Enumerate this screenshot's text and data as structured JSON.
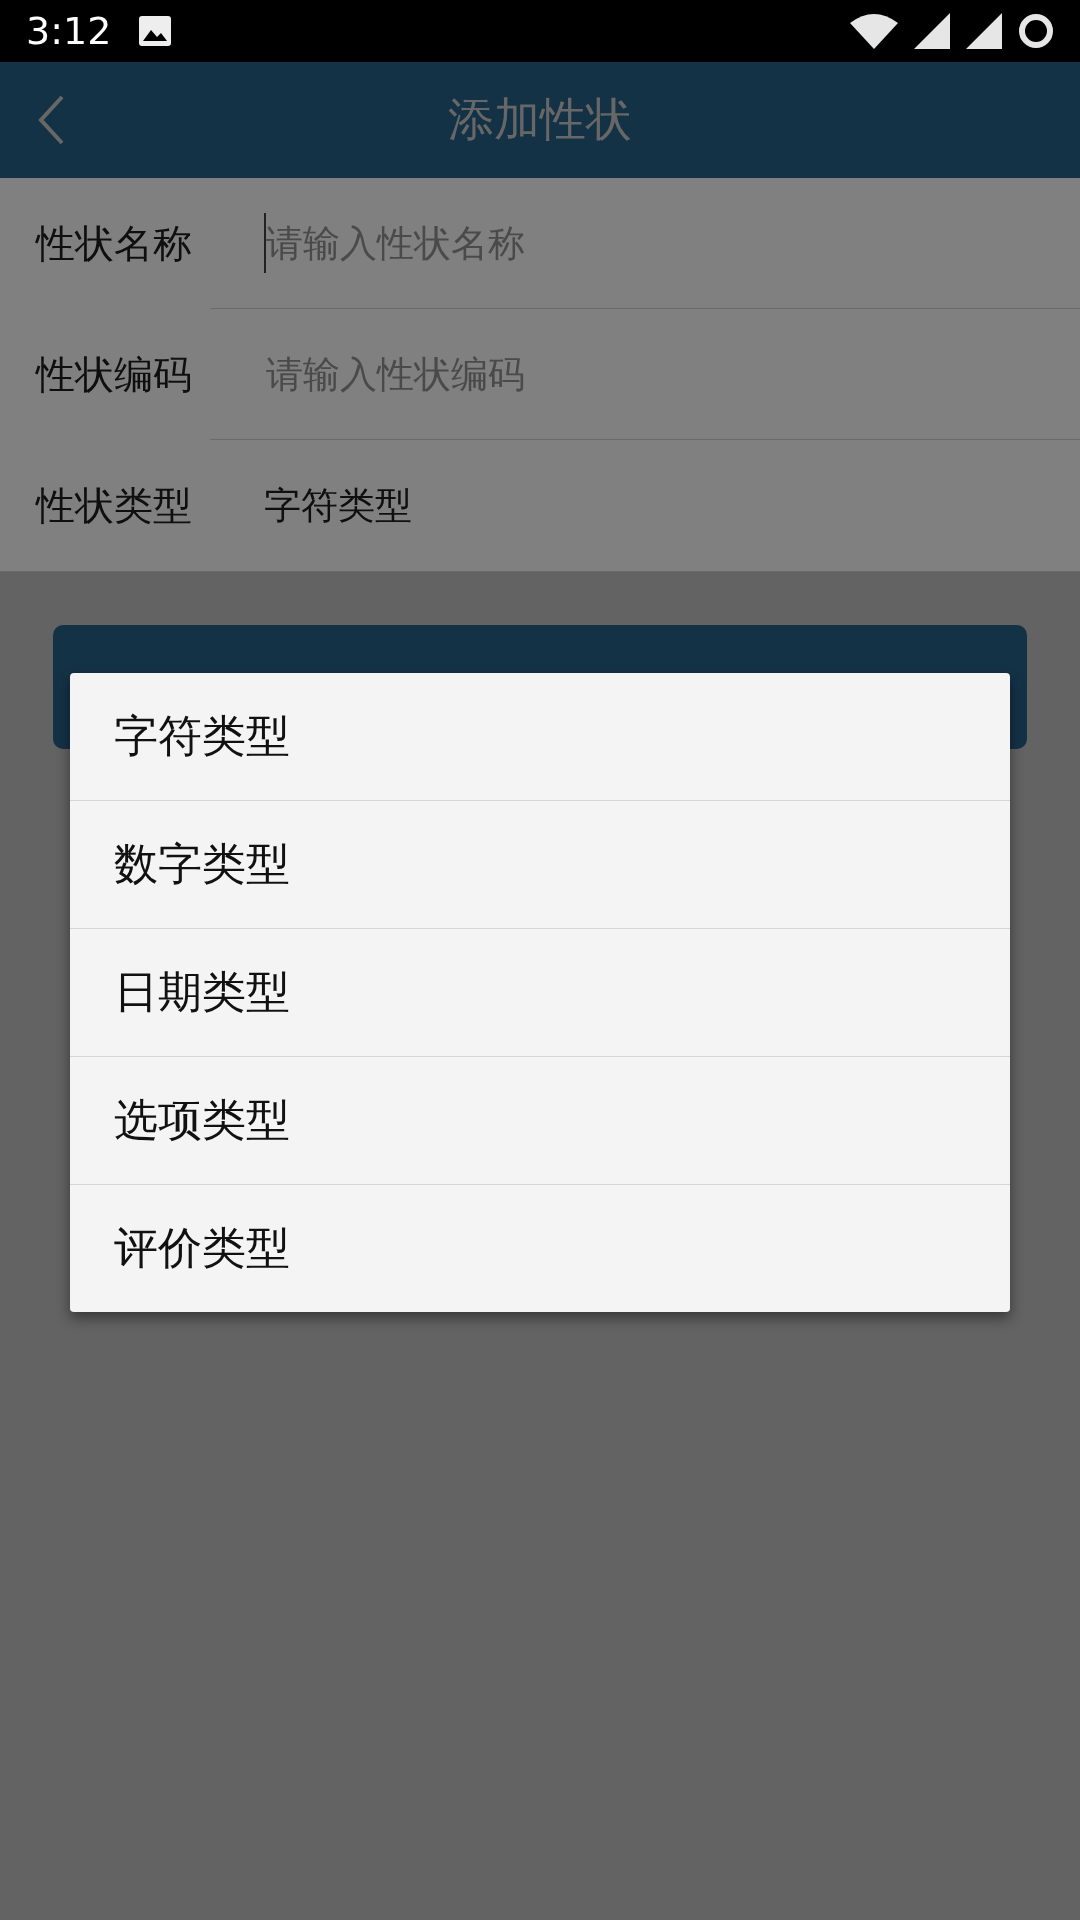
{
  "status_bar": {
    "time": "3:12"
  },
  "app_bar": {
    "title": "添加性状"
  },
  "form": [
    {
      "label": "性状名称",
      "kind": "input",
      "placeholder": "请输入性状名称",
      "focused": true
    },
    {
      "label": "性状编码",
      "kind": "input",
      "placeholder": "请输入性状编码",
      "focused": false
    },
    {
      "label": "性状类型",
      "kind": "select",
      "value": "字符类型"
    }
  ],
  "menu": {
    "options": [
      "字符类型",
      "数字类型",
      "日期类型",
      "选项类型",
      "评价类型"
    ]
  }
}
